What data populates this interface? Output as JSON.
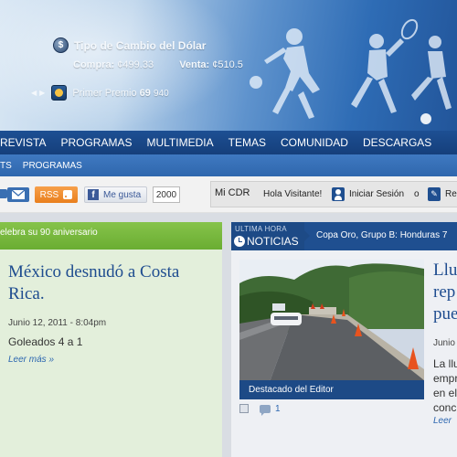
{
  "header": {
    "exchange": {
      "title": "Tipo de Cambio del Dólar",
      "buy_label": "Compra:",
      "buy_value": "¢499.33",
      "sell_label": "Venta:",
      "sell_value": "¢510.5"
    },
    "lottery": {
      "label": "Primer Premio",
      "number": "69",
      "series": "940"
    }
  },
  "nav": {
    "main": [
      "REVISTA",
      "PROGRAMAS",
      "MULTIMEDIA",
      "TEMAS",
      "COMUNIDAD",
      "DESCARGAS"
    ],
    "sub": [
      "TS",
      "PROGRAMAS"
    ]
  },
  "toolbar": {
    "rss_label": "RSS",
    "like_label": "Me gusta",
    "like_count": "2000",
    "mi_cdr": "Mi CDR",
    "greeting": "Hola Visitante!",
    "login_label": "Iniciar Sesión",
    "or_label": "o",
    "register_label": "Re"
  },
  "featured_left": {
    "banner": "elebra su 90 aniversario",
    "title": "México desnudó a Costa Rica.",
    "date": "Junio 12, 2011 - 8:04pm",
    "summary": "Goleados 4 a 1",
    "more": "Leer más »"
  },
  "news": {
    "tab_small": "ULTIMA HORA",
    "tab_label": "NOTICIAS",
    "ticker": "Copa Oro, Grupo B: Honduras 7",
    "photo_caption": "Destacado del Editor",
    "comment_count": "1",
    "story_title_lines": [
      "Llu",
      "rep",
      "pue"
    ],
    "story_date": "Junio",
    "story_summary_lines": [
      "La llu",
      "empr",
      "en el",
      "concl"
    ],
    "story_more": "Leer"
  },
  "colors": {
    "nav_dark": "#1d4f93",
    "nav_light": "#3f79c1",
    "headline_blue": "#1e4c8f",
    "green_banner": "#6aad32",
    "rss_orange": "#e97f1d"
  }
}
